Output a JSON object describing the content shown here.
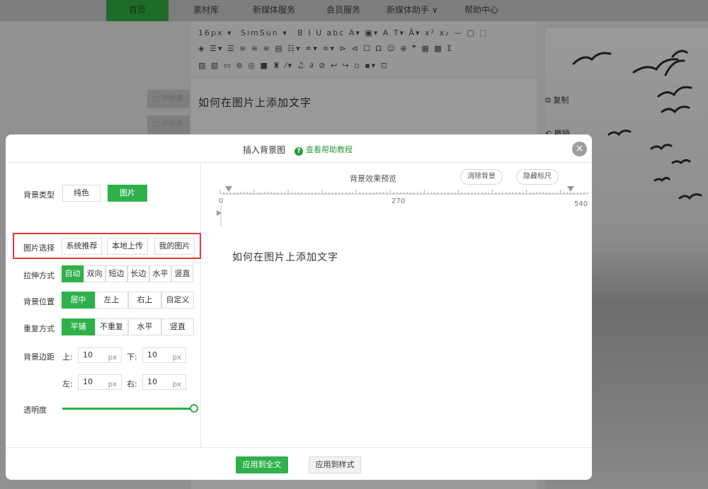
{
  "nav": {
    "items": [
      "首页",
      "素材库",
      "新媒体服务",
      "会员服务",
      "新媒体助手 ∨",
      "帮助中心"
    ]
  },
  "toolbar": {
    "font_size": "16px ▾",
    "font_family": "SimSun ▾"
  },
  "editor": {
    "content_text": "如何在图片上添加文字",
    "side_chip_1": "中秋素",
    "side_chip_2": "中秋素"
  },
  "side_actions": {
    "copy": "复制",
    "undo": "撤销"
  },
  "modal": {
    "title": "插入背景图",
    "help_text": "查看帮助教程",
    "help_icon_glyph": "?",
    "close_glyph": "×"
  },
  "settings": {
    "bg_type": {
      "label": "背景类型",
      "options": [
        "纯色",
        "图片"
      ],
      "selected": "图片"
    },
    "image_source": {
      "label": "图片选择",
      "options": [
        "系统推荐",
        "本地上传",
        "我的图片"
      ]
    },
    "stretch": {
      "label": "拉伸方式",
      "options": [
        "自动",
        "双向",
        "短边",
        "长边",
        "水平",
        "竖直"
      ],
      "selected": "自动"
    },
    "position": {
      "label": "背景位置",
      "options": [
        "居中",
        "左上",
        "右上",
        "自定义"
      ],
      "selected": "居中"
    },
    "repeat": {
      "label": "重复方式",
      "options": [
        "平铺",
        "不重复",
        "水平",
        "竖直"
      ],
      "selected": "平铺"
    },
    "margin": {
      "label": "背景边距",
      "top_label": "上:",
      "bottom_label": "下:",
      "left_label": "左:",
      "right_label": "右:",
      "top": "10",
      "bottom": "10",
      "left": "10",
      "right": "10",
      "unit": "px"
    },
    "opacity": {
      "label": "透明度",
      "value": 1.0
    }
  },
  "preview": {
    "title": "背景效果预览",
    "clear_button": "消除背景",
    "hide_ruler_button": "隐藏标尺",
    "ruler_start": "0",
    "ruler_mid": "270",
    "ruler_end": "540",
    "ruler_left_mark": "43",
    "text": "如何在图片上添加文字"
  },
  "footer": {
    "apply_all": "应用到全文",
    "apply_style": "应用到样式"
  },
  "colors": {
    "accent": "#2eb14b",
    "highlight": "#e53935",
    "link": "#2a9a3e"
  }
}
